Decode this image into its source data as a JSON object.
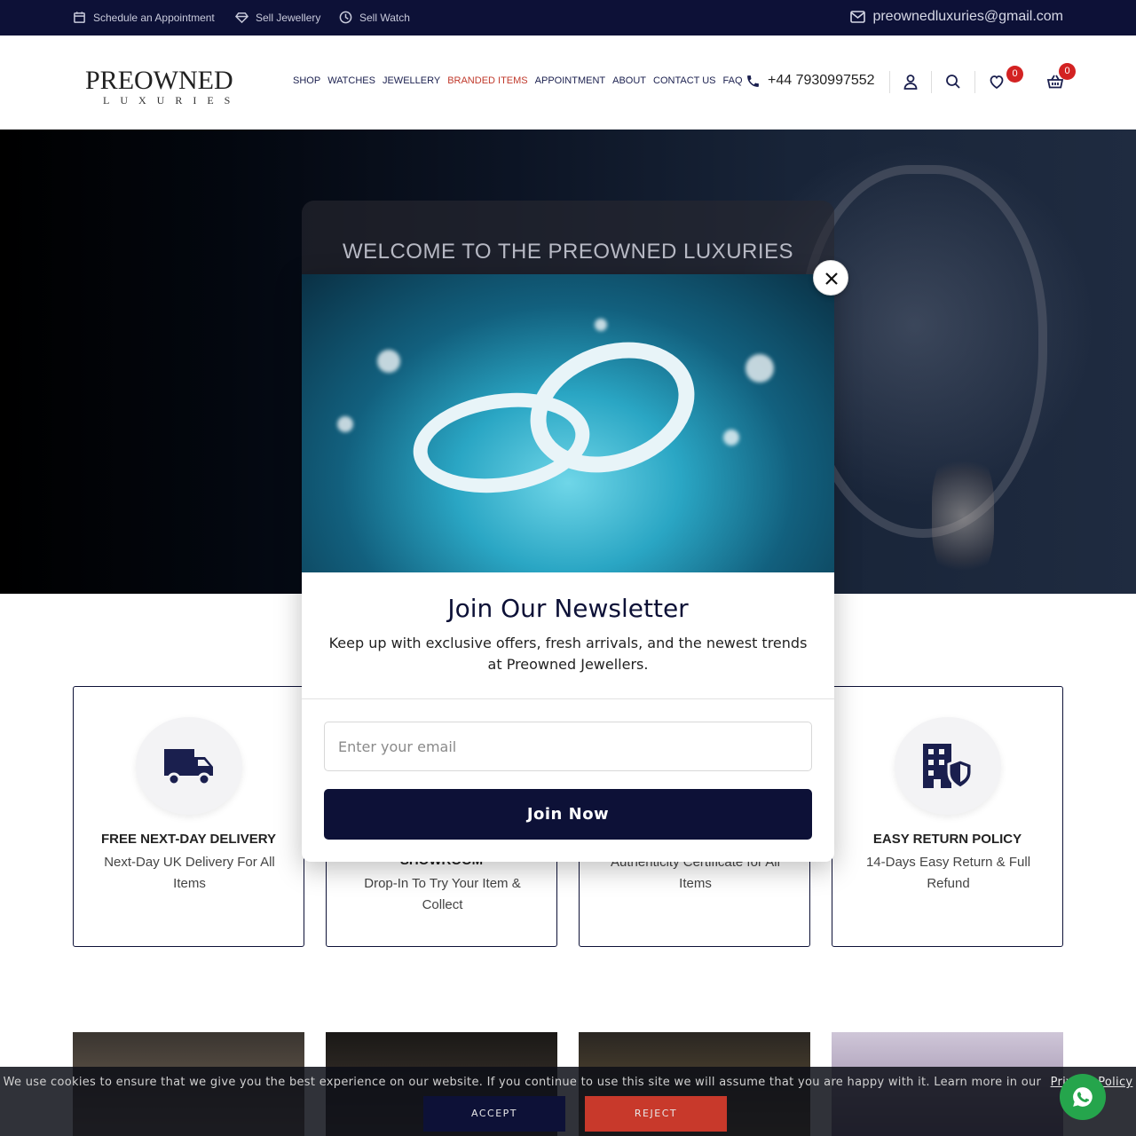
{
  "topbar": {
    "schedule_label": "Schedule an Appointment",
    "sell_jewellery_label": "Sell Jewellery",
    "sell_watch_label": "Sell Watch",
    "email": "preownedluxuries@gmail.com"
  },
  "header": {
    "logo_line1": "PREOWNED",
    "logo_line2": "LUXURIES",
    "nav": [
      "SHOP",
      "WATCHES",
      "JEWELLERY",
      "BRANDED ITEMS",
      "APPOINTMENT",
      "ABOUT",
      "CONTACT US",
      "FAQ"
    ],
    "active_nav": "BRANDED ITEMS",
    "phone": "+44 7930997552",
    "wishlist_count": "0",
    "cart_count": "0"
  },
  "hero": {
    "title": "WELCOME TO THE PREOWNED LUXURIES"
  },
  "features": [
    {
      "title": "FREE NEXT-DAY DELIVERY",
      "text": "Next-Day UK Delivery For All Items",
      "icon": "truck-icon"
    },
    {
      "title": "SHOWROOM",
      "text": "Drop-In To Try Your Item & Collect",
      "icon": "store-icon"
    },
    {
      "title": "",
      "text": "Authenticity Certificate for All Items",
      "icon": "certificate-icon"
    },
    {
      "title": "EASY RETURN POLICY",
      "text": "14-Days Easy Return & Full Refund",
      "icon": "building-shield-icon"
    }
  ],
  "modal": {
    "title": "Join Our Newsletter",
    "text": "Keep up with exclusive offers, fresh arrivals, and the newest trends at Preowned Jewellers.",
    "email_placeholder": "Enter your email",
    "button_label": "Join Now"
  },
  "cookie": {
    "text": "We use cookies to ensure that we give you the best experience on our website. If you continue to use this site we will assume that you are happy with it. Learn more in our",
    "link_label": "Privacy Policy",
    "accept_label": "ACCEPT",
    "reject_label": "REJECT"
  },
  "colors": {
    "navy": "#0d1137",
    "accent_red": "#c0392b",
    "badge_red": "#d32222",
    "whatsapp_green": "#25a54c"
  }
}
